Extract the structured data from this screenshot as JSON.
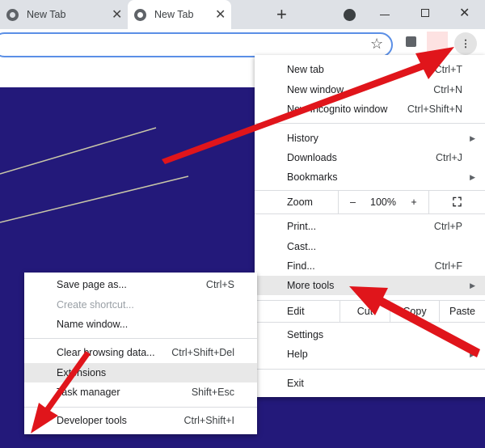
{
  "tabs": [
    {
      "label": "New Tab",
      "active": false
    },
    {
      "label": "New Tab",
      "active": true
    }
  ],
  "window_icons": [
    "new-tab-plus-icon",
    "tab-search-icon",
    "minimize-icon",
    "restore-icon",
    "close-icon"
  ],
  "toolbar": {
    "icons": [
      "bookmark-star-icon",
      "extensions-puzzle-icon",
      "profile-icon",
      "menu-kebab-icon"
    ]
  },
  "main_menu": {
    "new_tab": {
      "label": "New tab",
      "shortcut": "Ctrl+T"
    },
    "new_window": {
      "label": "New window",
      "shortcut": "Ctrl+N"
    },
    "incognito": {
      "label": "New Incognito window",
      "shortcut": "Ctrl+Shift+N"
    },
    "history": {
      "label": "History"
    },
    "downloads": {
      "label": "Downloads",
      "shortcut": "Ctrl+J"
    },
    "bookmarks": {
      "label": "Bookmarks"
    },
    "zoom": {
      "label": "Zoom",
      "minus": "–",
      "value": "100%",
      "plus": "+"
    },
    "print": {
      "label": "Print...",
      "shortcut": "Ctrl+P"
    },
    "cast": {
      "label": "Cast..."
    },
    "find": {
      "label": "Find...",
      "shortcut": "Ctrl+F"
    },
    "more_tools": {
      "label": "More tools"
    },
    "edit": {
      "label": "Edit",
      "cut": "Cut",
      "copy": "Copy",
      "paste": "Paste"
    },
    "settings": {
      "label": "Settings"
    },
    "help": {
      "label": "Help"
    },
    "exit": {
      "label": "Exit"
    }
  },
  "sub_menu": {
    "save_page": {
      "label": "Save page as...",
      "shortcut": "Ctrl+S"
    },
    "create_shortcut": {
      "label": "Create shortcut..."
    },
    "name_window": {
      "label": "Name window..."
    },
    "clear_data": {
      "label": "Clear browsing data...",
      "shortcut": "Ctrl+Shift+Del"
    },
    "extensions": {
      "label": "Extensions"
    },
    "task_manager": {
      "label": "Task manager",
      "shortcut": "Shift+Esc"
    },
    "dev_tools": {
      "label": "Developer tools",
      "shortcut": "Ctrl+Shift+I"
    }
  },
  "colors": {
    "annotation_arrow": "#e0151b",
    "page_background": "#23197a",
    "highlight": "#e8e8e8"
  }
}
